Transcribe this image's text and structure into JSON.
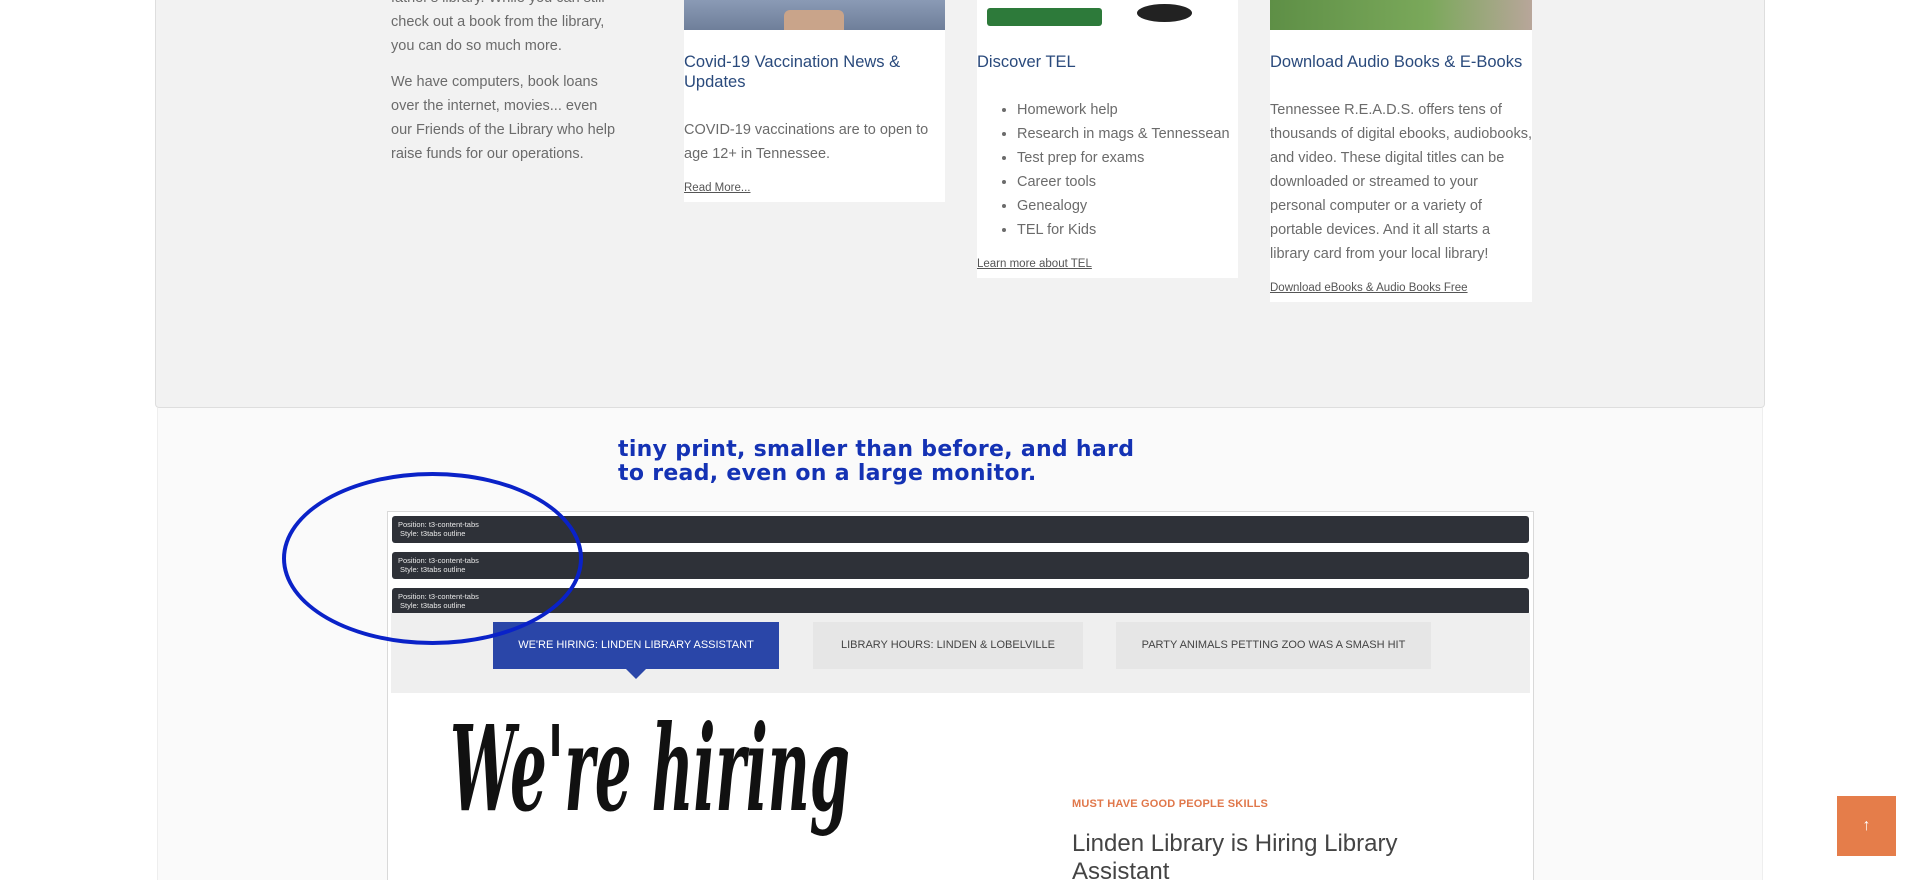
{
  "intro": {
    "p1": "father's library. While you can still check out a book from the library, you can do so much more.",
    "p2": "We have computers, book loans over the internet, movies... even our Friends of the Library who help raise funds for our operations."
  },
  "cards": [
    {
      "title": "Covid-19 Vaccination News & Updates",
      "body": "COVID-19 vaccinations are to open to age 12+ in Tennessee.",
      "link": "Read More..."
    },
    {
      "title": "Discover TEL",
      "items": [
        "Homework help",
        "Research in mags & Tennessean",
        "Test prep for exams",
        "Career tools",
        "Genealogy",
        "TEL for Kids"
      ],
      "link": "Learn more about TEL"
    },
    {
      "title": "Download Audio Books & E-Books",
      "body": "Tennessee R.E.A.D.S. offers tens of thousands of digital ebooks, audiobooks, and video. These digital titles can be downloaded or streamed to your personal computer or a variety of portable devices. And it all starts a library card from your local library!",
      "link": "Download eBooks & Audio Books Free"
    }
  ],
  "annotation": "tiny print, smaller than before, and hard to read, even on a large monitor.",
  "position_bars": [
    {
      "line1": "Position: t3-content-tabs",
      "line2": "Style: t3tabs outline"
    },
    {
      "line1": "Position: t3-content-tabs",
      "line2": "Style: t3tabs outline"
    },
    {
      "line1": "Position: t3-content-tabs",
      "line2": "Style: t3tabs outline"
    }
  ],
  "tabs": [
    {
      "label": "We're Hiring: Linden Library Assistant",
      "active": true
    },
    {
      "label": "Library Hours: Linden & Lobelville",
      "active": false
    },
    {
      "label": "Party Animals Petting Zoo was a Smash Hit",
      "active": false
    }
  ],
  "feature": {
    "image_text": "We're hiring",
    "kicker": "MUST HAVE GOOD PEOPLE SKILLS",
    "title": "Linden Library is Hiring Library Assistant"
  },
  "back_to_top": {
    "icon": "arrow-up-icon",
    "glyph": "↑"
  },
  "colors": {
    "accent_blue": "#2a46a8",
    "annotation_blue": "#1432b4",
    "link_title": "#2a4a7c",
    "kicker_orange": "#e0774a",
    "top_button": "#e57d4a"
  }
}
